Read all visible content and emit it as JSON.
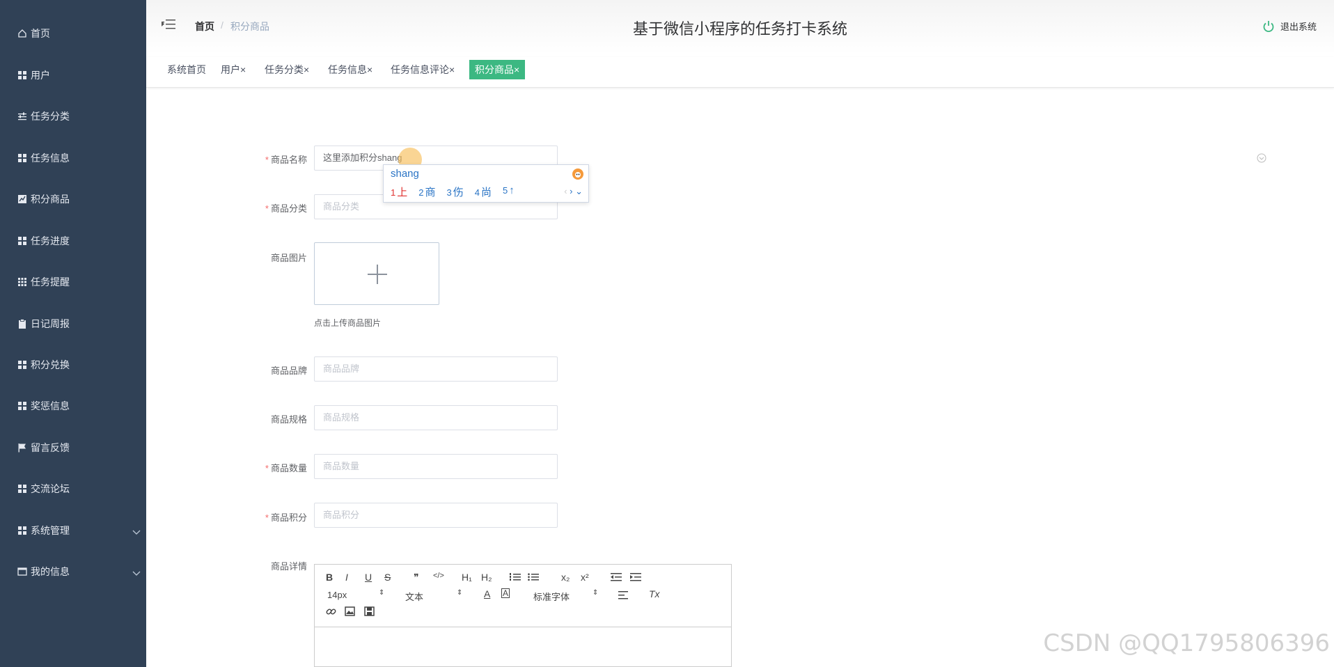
{
  "app": {
    "title": "基于微信小程序的任务打卡系统",
    "logout_label": "退出系统"
  },
  "breadcrumb": {
    "home": "首页",
    "separator": "/",
    "current": "积分商品"
  },
  "sidebar": {
    "items": [
      {
        "label": "首页",
        "icon": "home-icon"
      },
      {
        "label": "用户",
        "icon": "grid-icon"
      },
      {
        "label": "任务分类",
        "icon": "sliders-icon"
      },
      {
        "label": "任务信息",
        "icon": "grid-icon"
      },
      {
        "label": "积分商品",
        "icon": "chart-icon"
      },
      {
        "label": "任务进度",
        "icon": "grid-icon"
      },
      {
        "label": "任务提醒",
        "icon": "apps-icon"
      },
      {
        "label": "日记周报",
        "icon": "clipboard-icon"
      },
      {
        "label": "积分兑换",
        "icon": "grid-icon"
      },
      {
        "label": "奖惩信息",
        "icon": "grid-icon"
      },
      {
        "label": "留言反馈",
        "icon": "flag-icon"
      },
      {
        "label": "交流论坛",
        "icon": "grid-icon"
      },
      {
        "label": "系统管理",
        "icon": "grid-icon"
      },
      {
        "label": "我的信息",
        "icon": "window-icon"
      }
    ]
  },
  "tabs": [
    {
      "label": "系统首页",
      "closable": false
    },
    {
      "label": "用户",
      "closable": true
    },
    {
      "label": "任务分类",
      "closable": true
    },
    {
      "label": "任务信息",
      "closable": true
    },
    {
      "label": "任务信息评论",
      "closable": true
    },
    {
      "label": "积分商品",
      "closable": true,
      "active": true
    }
  ],
  "tab_close_glyph": "×",
  "form": {
    "name": {
      "label": "商品名称",
      "value": "这里添加积分shang",
      "required": true
    },
    "category": {
      "label": "商品分类",
      "placeholder": "商品分类",
      "required": true
    },
    "image": {
      "label": "商品图片",
      "hint": "点击上传商品图片"
    },
    "brand": {
      "label": "商品品牌",
      "placeholder": "商品品牌"
    },
    "spec": {
      "label": "商品规格",
      "placeholder": "商品规格"
    },
    "quantity": {
      "label": "商品数量",
      "placeholder": "商品数量",
      "required": true
    },
    "points": {
      "label": "商品积分",
      "placeholder": "商品积分",
      "required": true
    },
    "detail": {
      "label": "商品详情"
    },
    "required_mark": "*"
  },
  "ime": {
    "pinyin": "shang",
    "candidates": [
      {
        "n": "1",
        "text": "上"
      },
      {
        "n": "2",
        "text": "商"
      },
      {
        "n": "3",
        "text": "伤"
      },
      {
        "n": "4",
        "text": "尚"
      },
      {
        "n": "5",
        "text": "↑"
      }
    ]
  },
  "editor": {
    "font_size": "14px",
    "text_type": "文本",
    "font_family": "标准字体",
    "buttons": {
      "bold": "B",
      "italic": "I",
      "underline": "U",
      "strike": "S",
      "h1": "H₁",
      "h2": "H₂",
      "sub": "x₂",
      "sup": "x²",
      "quote": "❞",
      "code": "</>",
      "clear": "Tx"
    }
  },
  "watermark": "CSDN @QQ1795806396",
  "colors": {
    "sidebar_bg": "#304156",
    "accent": "#3cb882",
    "required": "#f56c6c"
  }
}
